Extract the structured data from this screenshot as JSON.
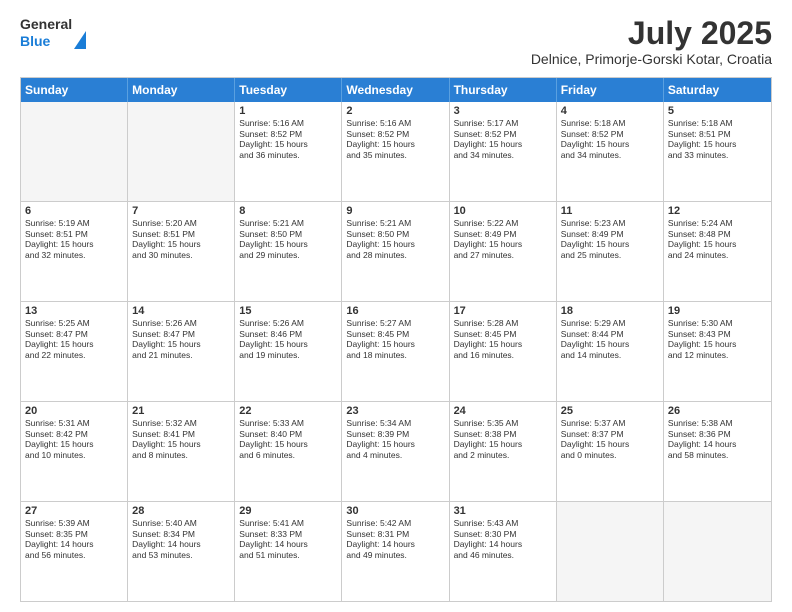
{
  "header": {
    "logo_general": "General",
    "logo_blue": "Blue",
    "month_title": "July 2025",
    "location": "Delnice, Primorje-Gorski Kotar, Croatia"
  },
  "days_of_week": [
    "Sunday",
    "Monday",
    "Tuesday",
    "Wednesday",
    "Thursday",
    "Friday",
    "Saturday"
  ],
  "weeks": [
    [
      {
        "day": "",
        "empty": true
      },
      {
        "day": "",
        "empty": true
      },
      {
        "day": "1",
        "sunrise": "Sunrise: 5:16 AM",
        "sunset": "Sunset: 8:52 PM",
        "daylight": "Daylight: 15 hours and 36 minutes."
      },
      {
        "day": "2",
        "sunrise": "Sunrise: 5:16 AM",
        "sunset": "Sunset: 8:52 PM",
        "daylight": "Daylight: 15 hours and 35 minutes."
      },
      {
        "day": "3",
        "sunrise": "Sunrise: 5:17 AM",
        "sunset": "Sunset: 8:52 PM",
        "daylight": "Daylight: 15 hours and 34 minutes."
      },
      {
        "day": "4",
        "sunrise": "Sunrise: 5:18 AM",
        "sunset": "Sunset: 8:52 PM",
        "daylight": "Daylight: 15 hours and 34 minutes."
      },
      {
        "day": "5",
        "sunrise": "Sunrise: 5:18 AM",
        "sunset": "Sunset: 8:51 PM",
        "daylight": "Daylight: 15 hours and 33 minutes."
      }
    ],
    [
      {
        "day": "6",
        "sunrise": "Sunrise: 5:19 AM",
        "sunset": "Sunset: 8:51 PM",
        "daylight": "Daylight: 15 hours and 32 minutes."
      },
      {
        "day": "7",
        "sunrise": "Sunrise: 5:20 AM",
        "sunset": "Sunset: 8:51 PM",
        "daylight": "Daylight: 15 hours and 30 minutes."
      },
      {
        "day": "8",
        "sunrise": "Sunrise: 5:21 AM",
        "sunset": "Sunset: 8:50 PM",
        "daylight": "Daylight: 15 hours and 29 minutes."
      },
      {
        "day": "9",
        "sunrise": "Sunrise: 5:21 AM",
        "sunset": "Sunset: 8:50 PM",
        "daylight": "Daylight: 15 hours and 28 minutes."
      },
      {
        "day": "10",
        "sunrise": "Sunrise: 5:22 AM",
        "sunset": "Sunset: 8:49 PM",
        "daylight": "Daylight: 15 hours and 27 minutes."
      },
      {
        "day": "11",
        "sunrise": "Sunrise: 5:23 AM",
        "sunset": "Sunset: 8:49 PM",
        "daylight": "Daylight: 15 hours and 25 minutes."
      },
      {
        "day": "12",
        "sunrise": "Sunrise: 5:24 AM",
        "sunset": "Sunset: 8:48 PM",
        "daylight": "Daylight: 15 hours and 24 minutes."
      }
    ],
    [
      {
        "day": "13",
        "sunrise": "Sunrise: 5:25 AM",
        "sunset": "Sunset: 8:47 PM",
        "daylight": "Daylight: 15 hours and 22 minutes."
      },
      {
        "day": "14",
        "sunrise": "Sunrise: 5:26 AM",
        "sunset": "Sunset: 8:47 PM",
        "daylight": "Daylight: 15 hours and 21 minutes."
      },
      {
        "day": "15",
        "sunrise": "Sunrise: 5:26 AM",
        "sunset": "Sunset: 8:46 PM",
        "daylight": "Daylight: 15 hours and 19 minutes."
      },
      {
        "day": "16",
        "sunrise": "Sunrise: 5:27 AM",
        "sunset": "Sunset: 8:45 PM",
        "daylight": "Daylight: 15 hours and 18 minutes."
      },
      {
        "day": "17",
        "sunrise": "Sunrise: 5:28 AM",
        "sunset": "Sunset: 8:45 PM",
        "daylight": "Daylight: 15 hours and 16 minutes."
      },
      {
        "day": "18",
        "sunrise": "Sunrise: 5:29 AM",
        "sunset": "Sunset: 8:44 PM",
        "daylight": "Daylight: 15 hours and 14 minutes."
      },
      {
        "day": "19",
        "sunrise": "Sunrise: 5:30 AM",
        "sunset": "Sunset: 8:43 PM",
        "daylight": "Daylight: 15 hours and 12 minutes."
      }
    ],
    [
      {
        "day": "20",
        "sunrise": "Sunrise: 5:31 AM",
        "sunset": "Sunset: 8:42 PM",
        "daylight": "Daylight: 15 hours and 10 minutes."
      },
      {
        "day": "21",
        "sunrise": "Sunrise: 5:32 AM",
        "sunset": "Sunset: 8:41 PM",
        "daylight": "Daylight: 15 hours and 8 minutes."
      },
      {
        "day": "22",
        "sunrise": "Sunrise: 5:33 AM",
        "sunset": "Sunset: 8:40 PM",
        "daylight": "Daylight: 15 hours and 6 minutes."
      },
      {
        "day": "23",
        "sunrise": "Sunrise: 5:34 AM",
        "sunset": "Sunset: 8:39 PM",
        "daylight": "Daylight: 15 hours and 4 minutes."
      },
      {
        "day": "24",
        "sunrise": "Sunrise: 5:35 AM",
        "sunset": "Sunset: 8:38 PM",
        "daylight": "Daylight: 15 hours and 2 minutes."
      },
      {
        "day": "25",
        "sunrise": "Sunrise: 5:37 AM",
        "sunset": "Sunset: 8:37 PM",
        "daylight": "Daylight: 15 hours and 0 minutes."
      },
      {
        "day": "26",
        "sunrise": "Sunrise: 5:38 AM",
        "sunset": "Sunset: 8:36 PM",
        "daylight": "Daylight: 14 hours and 58 minutes."
      }
    ],
    [
      {
        "day": "27",
        "sunrise": "Sunrise: 5:39 AM",
        "sunset": "Sunset: 8:35 PM",
        "daylight": "Daylight: 14 hours and 56 minutes."
      },
      {
        "day": "28",
        "sunrise": "Sunrise: 5:40 AM",
        "sunset": "Sunset: 8:34 PM",
        "daylight": "Daylight: 14 hours and 53 minutes."
      },
      {
        "day": "29",
        "sunrise": "Sunrise: 5:41 AM",
        "sunset": "Sunset: 8:33 PM",
        "daylight": "Daylight: 14 hours and 51 minutes."
      },
      {
        "day": "30",
        "sunrise": "Sunrise: 5:42 AM",
        "sunset": "Sunset: 8:31 PM",
        "daylight": "Daylight: 14 hours and 49 minutes."
      },
      {
        "day": "31",
        "sunrise": "Sunrise: 5:43 AM",
        "sunset": "Sunset: 8:30 PM",
        "daylight": "Daylight: 14 hours and 46 minutes."
      },
      {
        "day": "",
        "empty": true
      },
      {
        "day": "",
        "empty": true
      }
    ]
  ]
}
